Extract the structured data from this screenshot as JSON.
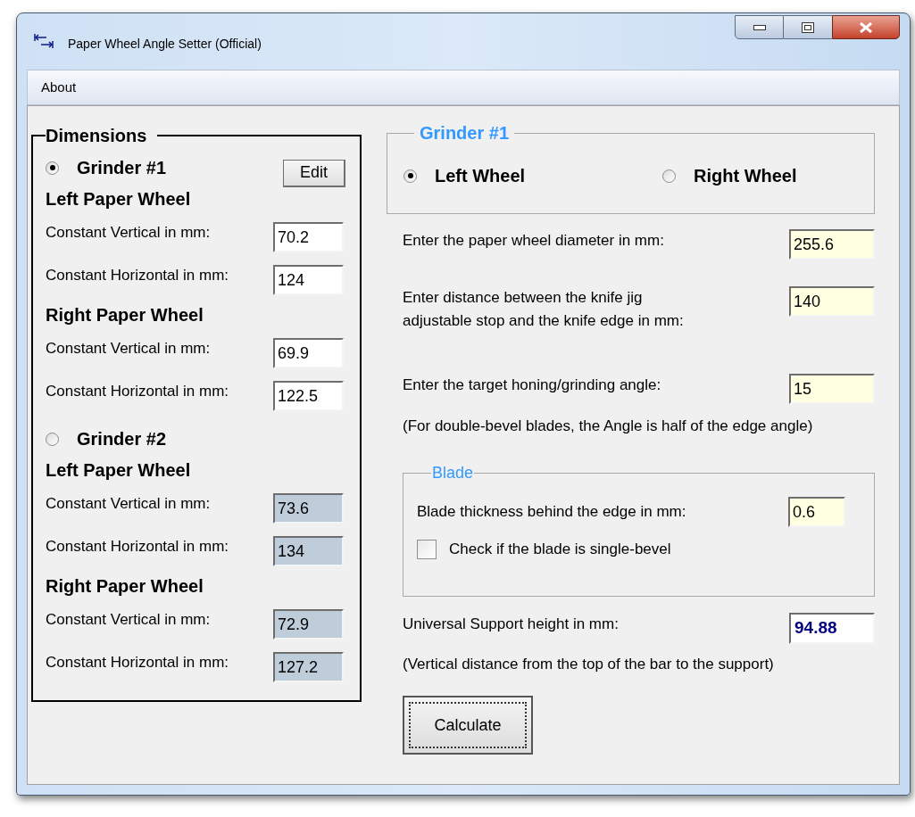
{
  "window": {
    "title": "Paper Wheel Angle Setter (Official)"
  },
  "menu": [
    "About"
  ],
  "dimensions": {
    "title": "Dimensions",
    "grinders": [
      {
        "label": "Grinder #1",
        "selected": true,
        "edit_button": "Edit",
        "disabled": false,
        "wheels": [
          {
            "heading": "Left Paper Wheel",
            "fields": [
              {
                "label": "Constant Vertical in mm:",
                "value": "70.2"
              },
              {
                "label": "Constant Horizontal in mm:",
                "value": "124"
              }
            ]
          },
          {
            "heading": "Right Paper Wheel",
            "fields": [
              {
                "label": "Constant Vertical in mm:",
                "value": "69.9"
              },
              {
                "label": "Constant Horizontal in mm:",
                "value": "122.5"
              }
            ]
          }
        ]
      },
      {
        "label": "Grinder #2",
        "selected": false,
        "disabled": true,
        "wheels": [
          {
            "heading": "Left Paper Wheel",
            "fields": [
              {
                "label": "Constant Vertical in mm:",
                "value": "73.6"
              },
              {
                "label": "Constant Horizontal in mm:",
                "value": "134"
              }
            ]
          },
          {
            "heading": "Right Paper Wheel",
            "fields": [
              {
                "label": "Constant Vertical in mm:",
                "value": "72.9"
              },
              {
                "label": "Constant Horizontal in mm:",
                "value": "127.2"
              }
            ]
          }
        ]
      }
    ]
  },
  "wheel_group": {
    "title": "Grinder #1",
    "options": [
      {
        "label": "Left Wheel",
        "selected": true
      },
      {
        "label": "Right Wheel",
        "selected": false
      }
    ]
  },
  "inputs": [
    {
      "label": "Enter the paper wheel diameter in mm:",
      "value": "255.6"
    },
    {
      "label": "Enter distance between the knife jig adjustable stop and the knife edge in mm:",
      "value": "140"
    },
    {
      "label": "Enter the target honing/grinding angle:",
      "value": "15"
    }
  ],
  "angle_note": "(For double-bevel blades, the Angle is half of the edge angle)",
  "blade": {
    "title": "Blade",
    "thickness": {
      "label": "Blade thickness behind the edge in mm:",
      "value": "0.6"
    },
    "single_bevel": {
      "label": "Check if the blade is single-bevel",
      "checked": false
    }
  },
  "result": {
    "label": "Universal Support height in mm:",
    "value": "94.88"
  },
  "result_note": "(Vertical distance from the top of the bar to the support)",
  "calculate_button": "Calculate"
}
